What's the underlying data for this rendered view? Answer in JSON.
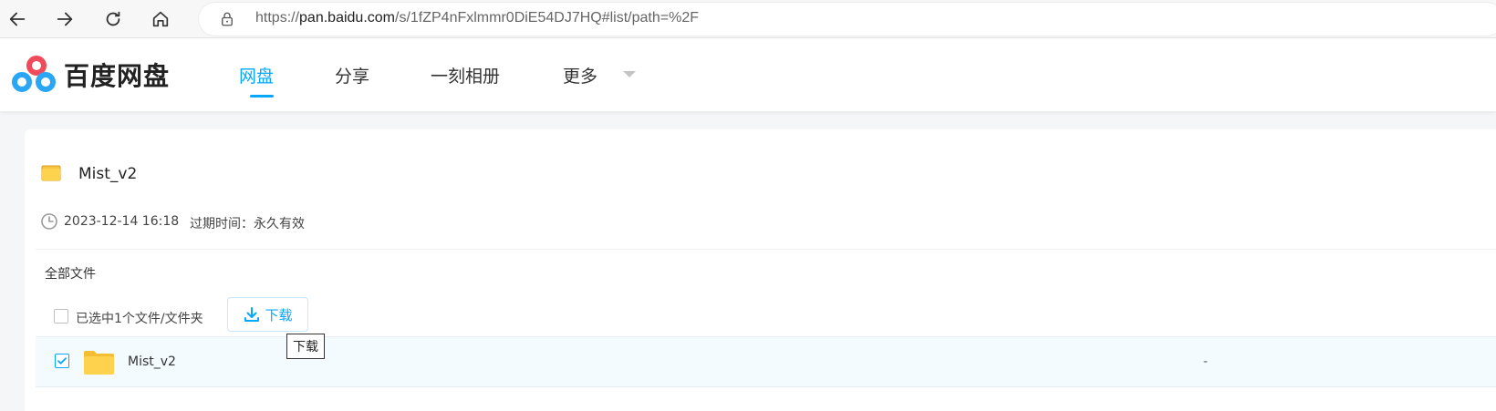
{
  "browser": {
    "url_prefix": "https://",
    "url_host": "pan.baidu.com",
    "url_path": "/s/1fZP4nFxlmmr0DiE54DJ7HQ#list/path=%2F",
    "icons": [
      "back-icon",
      "forward-icon",
      "reload-icon",
      "home-icon",
      "lock-icon"
    ]
  },
  "header": {
    "logo_text": "百度网盘",
    "nav": [
      {
        "label": "网盘",
        "active": true
      },
      {
        "label": "分享",
        "active": false
      },
      {
        "label": "一刻相册",
        "active": false
      },
      {
        "label": "更多",
        "active": false
      }
    ]
  },
  "share": {
    "title": "Mist_v2",
    "date": "2023-12-14 16:18",
    "expire": "过期时间：永久有效"
  },
  "breadcrumb": "全部文件",
  "toolbar": {
    "selection_text": "已选中1个文件/文件夹",
    "download_label": "下载"
  },
  "files": [
    {
      "name": "Mist_v2",
      "size": "-",
      "selected": true,
      "type": "folder"
    }
  ],
  "tooltip": "下载",
  "colors": {
    "accent": "#06a7ff",
    "folder": "#ffd24d",
    "row_selected_bg": "#f4fbff"
  }
}
